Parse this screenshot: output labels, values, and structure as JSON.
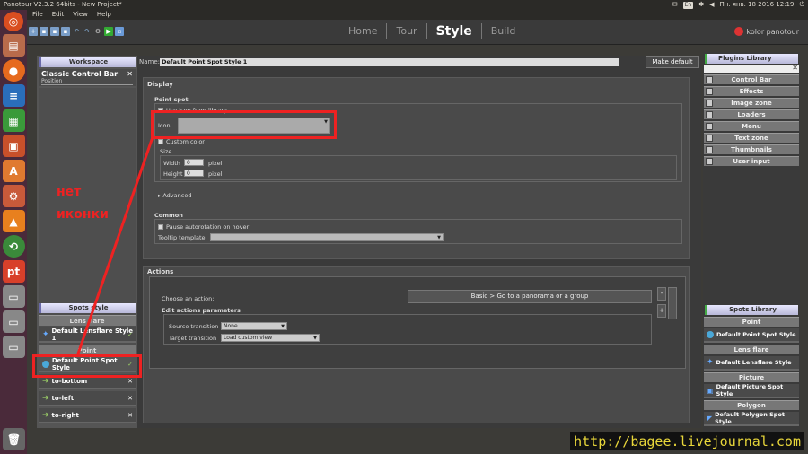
{
  "system": {
    "window_title": "Panotour V2.3.2 64bits - New Project*",
    "kb_layout": "En",
    "datetime": "Пн. янв. 18 2016 12:19"
  },
  "menu": [
    "File",
    "Edit",
    "View",
    "Help"
  ],
  "nav": {
    "tabs": [
      "Home",
      "Tour",
      "Style",
      "Build"
    ],
    "active": "Style",
    "brand": "kolor panotour"
  },
  "workspace": {
    "title": "Workspace",
    "item_title": "Classic Control Bar",
    "item_sub": "Position"
  },
  "spots_style": {
    "title": "Spots style",
    "cat_lens": "Lens flare",
    "lens_item": "Default Lensflare Style 1",
    "cat_point": "Point",
    "point_item": "Default Point Spot Style",
    "items": [
      "to-bottom",
      "to-left",
      "to-right"
    ]
  },
  "editor": {
    "name_label": "Name:",
    "name_value": "Default Point Spot Style 1",
    "make_default": "Make default",
    "display": "Display",
    "point_spot": "Point spot",
    "use_icon": "Use icon from library",
    "icon_label": "Icon",
    "custom_color": "Custom color",
    "size": "Size",
    "width_label": "Width",
    "width_value": "0",
    "height_label": "Height",
    "height_value": "0",
    "pixel": "pixel",
    "advanced": "Advanced",
    "common": "Common",
    "pause_autorotation": "Pause autorotation on hover",
    "tooltip_template": "Tooltip template",
    "actions": "Actions",
    "choose_action": "Choose an action:",
    "action_value": "Basic > Go to a panorama or a group",
    "edit_params": "Edit actions parameters",
    "source_transition": "Source transition",
    "source_value": "None",
    "target_transition": "Target transition",
    "target_value": "Load custom view",
    "minus": "-",
    "plus": "+"
  },
  "plugins": {
    "title": "Plugins Library",
    "items": [
      "Control Bar",
      "Effects",
      "Image zone",
      "Loaders",
      "Menu",
      "Text zone",
      "Thumbnails",
      "User input"
    ]
  },
  "spots_library": {
    "title": "Spots Library",
    "cat_point": "Point",
    "point_item": "Default Point Spot Style",
    "cat_lens": "Lens flare",
    "lens_item": "Default Lensflare Style",
    "cat_picture": "Picture",
    "picture_item": "Default Picture Spot Style",
    "cat_polygon": "Polygon",
    "polygon_item": "Default Polygon Spot Style"
  },
  "annotation": {
    "line1": "нет",
    "line2": "иконки"
  },
  "watermark": "http://bagee.livejournal.com"
}
